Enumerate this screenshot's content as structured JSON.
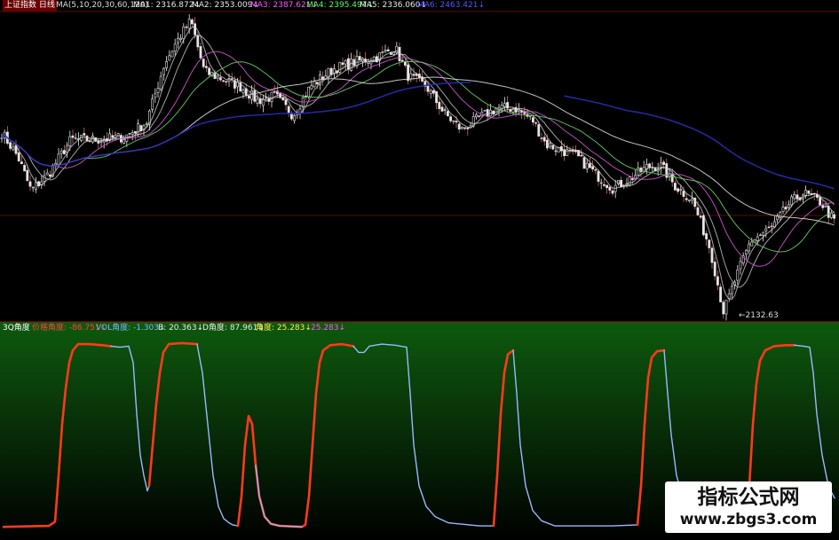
{
  "header": {
    "title": "上证指数 日线",
    "ma_params": "MA(5,10,20,30,60,120)",
    "ma_items": [
      {
        "label": "MA1: 2316.872↓",
        "color": "#e8e8e8"
      },
      {
        "label": "MA2: 2353.009↓",
        "color": "#e8e8e8"
      },
      {
        "label": "MA3: 2387.621↓",
        "color": "#ff55ff"
      },
      {
        "label": "MA4: 2395.497↓",
        "color": "#55ff55"
      },
      {
        "label": "MA5: 2336.060↓",
        "color": "#e8e8e8"
      },
      {
        "label": "MA6: 2463.421↓",
        "color": "#5555ff"
      }
    ]
  },
  "sub_header": {
    "title": "3Q角度",
    "items": [
      {
        "label": "价格角度: -86.751↓",
        "color": "#ff4040"
      },
      {
        "label": "VOL角度: -1.303↓",
        "color": "#80b0ff"
      },
      {
        "label": "B: 20.363↓",
        "color": "#e8e8e8"
      },
      {
        "label": "D角度: 87.961↓",
        "color": "#e8e8e8"
      },
      {
        "label": "角度: 25.283↓",
        "color": "#ffee55"
      },
      {
        "label": "25.283↓",
        "color": "#ff55ff"
      }
    ]
  },
  "low_label": "←2132.63",
  "watermark": {
    "title": "指标公式网",
    "url": "www.zbgs3.com"
  },
  "colors": {
    "candle": "#e6e6e6",
    "ma_white": "#d8d8d8",
    "ma_magenta": "#cc55cc",
    "ma_green": "#66cc66",
    "ma_blue": "#2a2ab0",
    "sep_red": "#7a1010",
    "angle_red": "#ff3a1a",
    "angle_blue": "#9ab8ff"
  },
  "chart_data": [
    {
      "type": "line",
      "title": "上证指数 日线",
      "xlabel": "",
      "ylabel": "",
      "ylim": [
        2130,
        2760
      ],
      "grid": false,
      "low_annotation": 2132.63,
      "price_anchors": [
        [
          0,
          2520
        ],
        [
          20,
          2465
        ],
        [
          35,
          2395
        ],
        [
          55,
          2430
        ],
        [
          80,
          2500
        ],
        [
          110,
          2500
        ],
        [
          140,
          2505
        ],
        [
          165,
          2535
        ],
        [
          185,
          2655
        ],
        [
          200,
          2705
        ],
        [
          215,
          2745
        ],
        [
          230,
          2640
        ],
        [
          250,
          2625
        ],
        [
          270,
          2610
        ],
        [
          290,
          2580
        ],
        [
          310,
          2590
        ],
        [
          330,
          2550
        ],
        [
          350,
          2610
        ],
        [
          375,
          2645
        ],
        [
          400,
          2660
        ],
        [
          425,
          2670
        ],
        [
          445,
          2690
        ],
        [
          460,
          2630
        ],
        [
          480,
          2610
        ],
        [
          500,
          2555
        ],
        [
          520,
          2520
        ],
        [
          540,
          2545
        ],
        [
          560,
          2565
        ],
        [
          580,
          2565
        ],
        [
          600,
          2540
        ],
        [
          615,
          2490
        ],
        [
          630,
          2480
        ],
        [
          650,
          2465
        ],
        [
          670,
          2430
        ],
        [
          690,
          2400
        ],
        [
          710,
          2420
        ],
        [
          730,
          2445
        ],
        [
          745,
          2445
        ],
        [
          760,
          2405
        ],
        [
          780,
          2375
        ],
        [
          800,
          2275
        ],
        [
          815,
          2145
        ],
        [
          830,
          2220
        ],
        [
          845,
          2290
        ],
        [
          870,
          2320
        ],
        [
          890,
          2370
        ],
        [
          905,
          2390
        ],
        [
          925,
          2370
        ],
        [
          940,
          2330
        ]
      ],
      "series": [
        {
          "name": "MA1",
          "period": 5
        },
        {
          "name": "MA2",
          "period": 10
        },
        {
          "name": "MA3",
          "period": 20
        },
        {
          "name": "MA4",
          "period": 30
        },
        {
          "name": "MA5",
          "period": 60
        },
        {
          "name": "MA6",
          "period": 120
        }
      ]
    },
    {
      "type": "line",
      "title": "3Q角度",
      "xlabel": "",
      "ylabel": "",
      "ylim": [
        -95,
        95
      ],
      "grid": false,
      "series": [
        {
          "name": "价格角度",
          "color": "#ff3a1a",
          "points": [
            [
              4,
              -90
            ],
            [
              55,
              -89
            ],
            [
              62,
              -85
            ],
            [
              66,
              -40
            ],
            [
              70,
              10
            ],
            [
              74,
              45
            ],
            [
              78,
              70
            ],
            [
              82,
              82
            ],
            [
              88,
              88
            ],
            [
              100,
              88
            ],
            [
              115,
              87
            ],
            [
              125,
              86
            ]
          ]
        },
        {
          "name": "VOL角度",
          "color": "#9ab8ff",
          "points": [
            [
              125,
              86
            ],
            [
              135,
              85
            ],
            [
              145,
              86
            ],
            [
              150,
              70
            ],
            [
              154,
              20
            ],
            [
              158,
              -20
            ],
            [
              162,
              -40
            ],
            [
              166,
              -55
            ],
            [
              168,
              -50
            ]
          ]
        },
        {
          "name": "价格角度",
          "color": "#ff3a1a",
          "points": [
            [
              168,
              -50
            ],
            [
              172,
              -10
            ],
            [
              176,
              30
            ],
            [
              180,
              60
            ],
            [
              184,
              80
            ],
            [
              190,
              88
            ],
            [
              205,
              89
            ],
            [
              222,
              88
            ]
          ]
        },
        {
          "name": "VOL角度",
          "color": "#9ab8ff",
          "points": [
            [
              222,
              88
            ],
            [
              228,
              60
            ],
            [
              234,
              10
            ],
            [
              240,
              -40
            ],
            [
              246,
              -70
            ],
            [
              252,
              -82
            ],
            [
              258,
              -86
            ],
            [
              262,
              -88
            ],
            [
              268,
              -89
            ]
          ]
        },
        {
          "name": "价格角度",
          "color": "#ff3a1a",
          "points": [
            [
              268,
              -89
            ],
            [
              272,
              -60
            ],
            [
              276,
              -10
            ],
            [
              280,
              18
            ],
            [
              284,
              10
            ],
            [
              288,
              -30
            ],
            [
              292,
              -60
            ],
            [
              298,
              -80
            ],
            [
              305,
              -87
            ],
            [
              315,
              -89
            ],
            [
              340,
              -90
            ],
            [
              344,
              -88
            ]
          ]
        },
        {
          "name": "VOL角度",
          "color": "#9ab8ff",
          "points": [
            [
              288,
              -30
            ],
            [
              292,
              -60
            ],
            [
              298,
              -80
            ],
            [
              305,
              -87
            ],
            [
              315,
              -89
            ],
            [
              340,
              -90
            ]
          ]
        },
        {
          "name": "价格角度",
          "color": "#ff3a1a",
          "points": [
            [
              344,
              -88
            ],
            [
              348,
              -60
            ],
            [
              352,
              -10
            ],
            [
              356,
              40
            ],
            [
              360,
              70
            ],
            [
              364,
              82
            ],
            [
              372,
              87
            ],
            [
              385,
              88
            ],
            [
              398,
              86
            ]
          ]
        },
        {
          "name": "VOL角度",
          "color": "#9ab8ff",
          "points": [
            [
              398,
              86
            ],
            [
              404,
              80
            ],
            [
              410,
              80
            ],
            [
              416,
              86
            ],
            [
              430,
              88
            ],
            [
              445,
              87
            ],
            [
              458,
              85
            ]
          ]
        },
        {
          "name": "VOL角度",
          "color": "#9ab8ff",
          "points": [
            [
              458,
              85
            ],
            [
              462,
              40
            ],
            [
              466,
              -10
            ],
            [
              472,
              -50
            ],
            [
              480,
              -70
            ],
            [
              490,
              -80
            ],
            [
              505,
              -86
            ],
            [
              540,
              -89
            ],
            [
              556,
              -89
            ]
          ]
        },
        {
          "name": "价格角度",
          "color": "#ff3a1a",
          "points": [
            [
              556,
              -89
            ],
            [
              560,
              -40
            ],
            [
              564,
              20
            ],
            [
              568,
              60
            ],
            [
              572,
              78
            ],
            [
              578,
              82
            ]
          ]
        },
        {
          "name": "VOL角度",
          "color": "#9ab8ff",
          "points": [
            [
              578,
              82
            ],
            [
              582,
              40
            ],
            [
              586,
              -10
            ],
            [
              592,
              -50
            ],
            [
              600,
              -74
            ],
            [
              610,
              -84
            ],
            [
              625,
              -89
            ],
            [
              690,
              -89
            ],
            [
              718,
              -88
            ]
          ]
        },
        {
          "name": "价格角度",
          "color": "#ff3a1a",
          "points": [
            [
              718,
              -88
            ],
            [
              722,
              -50
            ],
            [
              726,
              10
            ],
            [
              730,
              55
            ],
            [
              734,
              75
            ],
            [
              740,
              81
            ],
            [
              748,
              82
            ]
          ]
        },
        {
          "name": "VOL角度",
          "color": "#9ab8ff",
          "points": [
            [
              748,
              82
            ],
            [
              752,
              40
            ],
            [
              756,
              0
            ],
            [
              762,
              -40
            ],
            [
              770,
              -64
            ],
            [
              780,
              -76
            ],
            [
              795,
              -84
            ],
            [
              820,
              -88
            ],
            [
              840,
              -88
            ]
          ]
        },
        {
          "name": "价格角度",
          "color": "#ff3a1a",
          "points": [
            [
              840,
              -88
            ],
            [
              844,
              -50
            ],
            [
              848,
              10
            ],
            [
              852,
              50
            ],
            [
              856,
              72
            ],
            [
              862,
              82
            ],
            [
              872,
              86
            ],
            [
              885,
              87
            ],
            [
              895,
              87
            ]
          ]
        },
        {
          "name": "VOL角度",
          "color": "#9ab8ff",
          "points": [
            [
              895,
              87
            ],
            [
              905,
              86
            ],
            [
              912,
              85
            ],
            [
              916,
              60
            ],
            [
              920,
              20
            ],
            [
              926,
              -20
            ],
            [
              933,
              -50
            ],
            [
              940,
              -62
            ]
          ]
        }
      ]
    }
  ]
}
